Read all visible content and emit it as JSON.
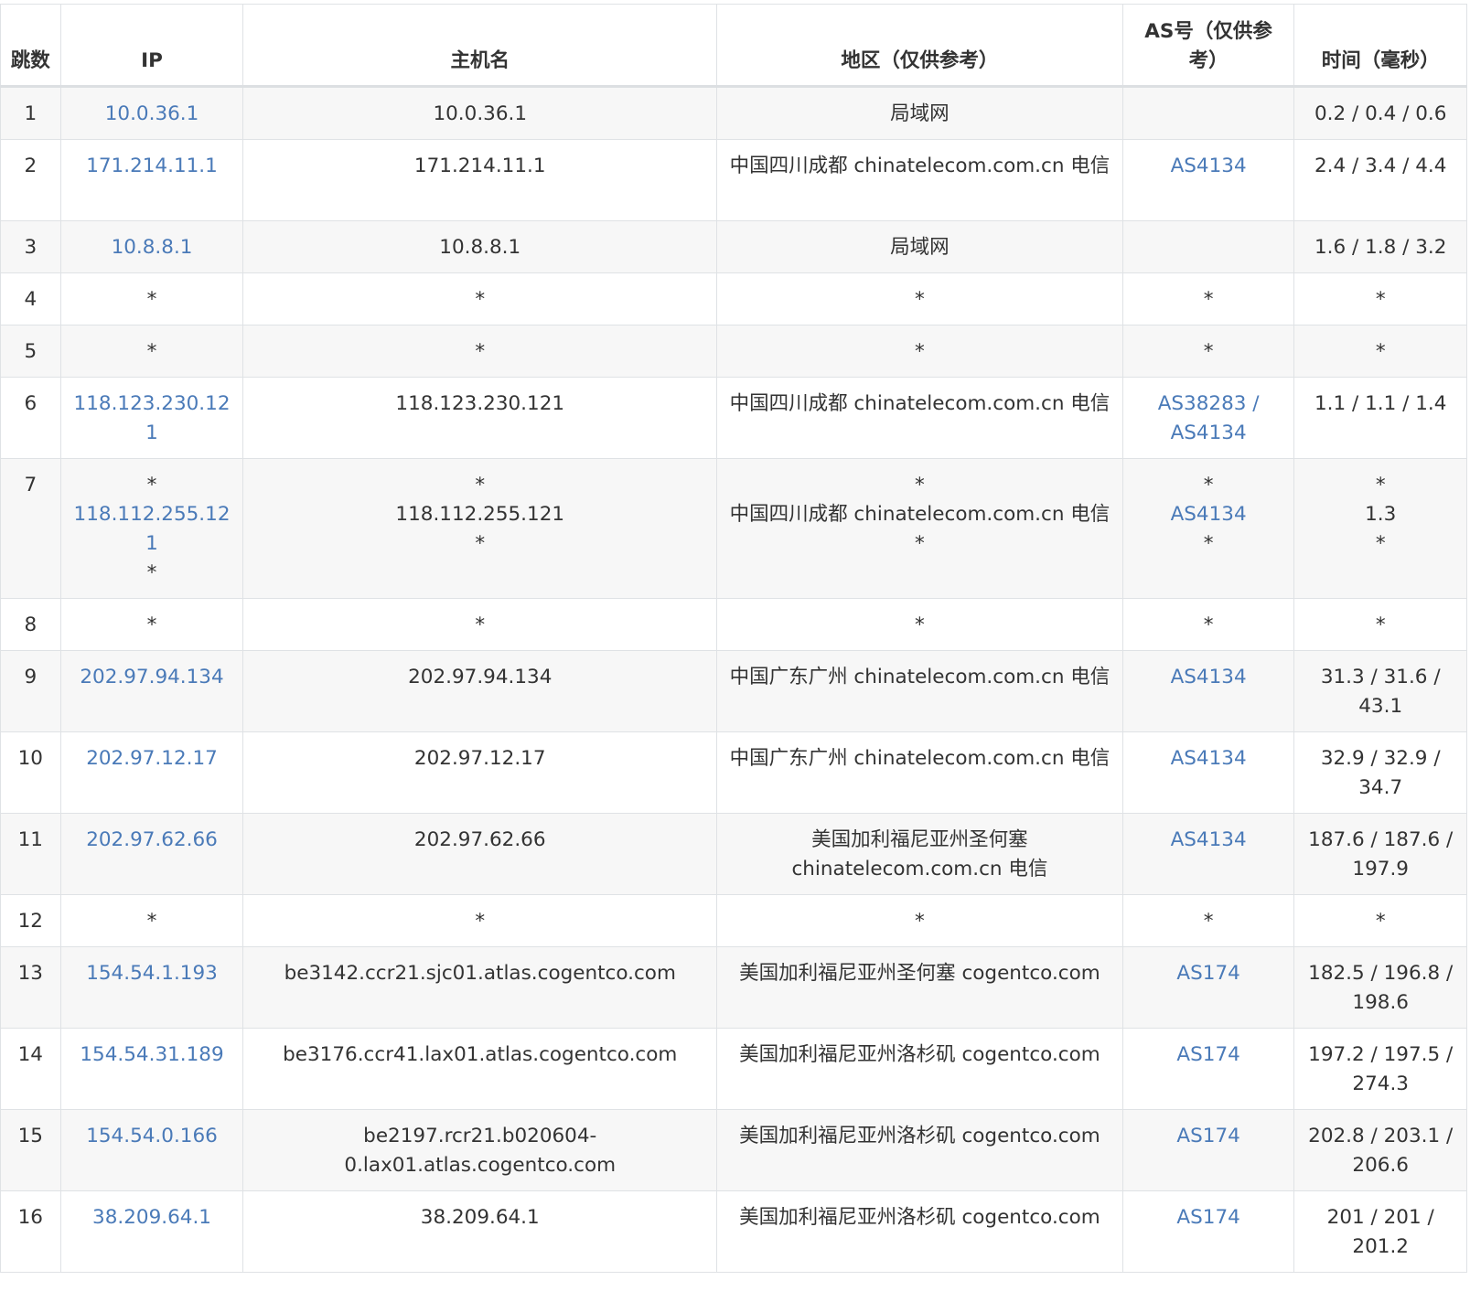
{
  "table": {
    "headers": [
      "跳数",
      "IP",
      "主机名",
      "地区（仅供参考）",
      "AS号（仅供参考）",
      "时间（毫秒）"
    ],
    "rows": [
      {
        "hop": "1",
        "ip": [
          "10.0.36.1"
        ],
        "host": [
          "10.0.36.1"
        ],
        "region": [
          "局域网"
        ],
        "asn": [],
        "time": [
          "0.2 / 0.4 / 0.6"
        ]
      },
      {
        "hop": "2",
        "ip": [
          "171.214.11.1"
        ],
        "host": [
          "171.214.11.1"
        ],
        "region": [
          "中国四川成都 chinatelecom.com.cn 电信"
        ],
        "asn": [
          "AS4134"
        ],
        "time": [
          "2.4 / 3.4 / 4.4"
        ]
      },
      {
        "hop": "3",
        "ip": [
          "10.8.8.1"
        ],
        "host": [
          "10.8.8.1"
        ],
        "region": [
          "局域网"
        ],
        "asn": [],
        "time": [
          "1.6 / 1.8 / 3.2"
        ]
      },
      {
        "hop": "4",
        "ip": [
          "*"
        ],
        "host": [
          "*"
        ],
        "region": [
          "*"
        ],
        "asn": [
          "*"
        ],
        "time": [
          "*"
        ]
      },
      {
        "hop": "5",
        "ip": [
          "*"
        ],
        "host": [
          "*"
        ],
        "region": [
          "*"
        ],
        "asn": [
          "*"
        ],
        "time": [
          "*"
        ]
      },
      {
        "hop": "6",
        "ip": [
          "118.123.230.121"
        ],
        "host": [
          "118.123.230.121"
        ],
        "region": [
          "中国四川成都 chinatelecom.com.cn 电信"
        ],
        "asn": [
          "AS38283 / AS4134"
        ],
        "time": [
          "1.1 / 1.1 / 1.4"
        ]
      },
      {
        "hop": "7",
        "ip": [
          "*",
          "118.112.255.121",
          "*"
        ],
        "host": [
          "*",
          "118.112.255.121",
          "*"
        ],
        "region": [
          "*",
          "中国四川成都 chinatelecom.com.cn 电信",
          "*"
        ],
        "asn": [
          "*",
          "AS4134",
          "*"
        ],
        "time": [
          "*",
          "1.3",
          "*"
        ]
      },
      {
        "hop": "8",
        "ip": [
          "*"
        ],
        "host": [
          "*"
        ],
        "region": [
          "*"
        ],
        "asn": [
          "*"
        ],
        "time": [
          "*"
        ]
      },
      {
        "hop": "9",
        "ip": [
          "202.97.94.134"
        ],
        "host": [
          "202.97.94.134"
        ],
        "region": [
          "中国广东广州 chinatelecom.com.cn 电信"
        ],
        "asn": [
          "AS4134"
        ],
        "time": [
          "31.3 / 31.6 / 43.1"
        ]
      },
      {
        "hop": "10",
        "ip": [
          "202.97.12.17"
        ],
        "host": [
          "202.97.12.17"
        ],
        "region": [
          "中国广东广州 chinatelecom.com.cn 电信"
        ],
        "asn": [
          "AS4134"
        ],
        "time": [
          "32.9 / 32.9 / 34.7"
        ]
      },
      {
        "hop": "11",
        "ip": [
          "202.97.62.66"
        ],
        "host": [
          "202.97.62.66"
        ],
        "region": [
          "美国加利福尼亚州圣何塞 chinatelecom.com.cn 电信"
        ],
        "asn": [
          "AS4134"
        ],
        "time": [
          "187.6 / 187.6 / 197.9"
        ]
      },
      {
        "hop": "12",
        "ip": [
          "*"
        ],
        "host": [
          "*"
        ],
        "region": [
          "*"
        ],
        "asn": [
          "*"
        ],
        "time": [
          "*"
        ]
      },
      {
        "hop": "13",
        "ip": [
          "154.54.1.193"
        ],
        "host": [
          "be3142.ccr21.sjc01.atlas.cogentco.com"
        ],
        "region": [
          "美国加利福尼亚州圣何塞 cogentco.com"
        ],
        "asn": [
          "AS174"
        ],
        "time": [
          "182.5 / 196.8 / 198.6"
        ]
      },
      {
        "hop": "14",
        "ip": [
          "154.54.31.189"
        ],
        "host": [
          "be3176.ccr41.lax01.atlas.cogentco.com"
        ],
        "region": [
          "美国加利福尼亚州洛杉矶 cogentco.com"
        ],
        "asn": [
          "AS174"
        ],
        "time": [
          "197.2 / 197.5 / 274.3"
        ]
      },
      {
        "hop": "15",
        "ip": [
          "154.54.0.166"
        ],
        "host": [
          "be2197.rcr21.b020604-0.lax01.atlas.cogentco.com"
        ],
        "region": [
          "美国加利福尼亚州洛杉矶 cogentco.com"
        ],
        "asn": [
          "AS174"
        ],
        "time": [
          "202.8 / 203.1 / 206.6"
        ]
      },
      {
        "hop": "16",
        "ip": [
          "38.209.64.1"
        ],
        "host": [
          "38.209.64.1"
        ],
        "region": [
          "美国加利福尼亚州洛杉矶 cogentco.com"
        ],
        "asn": [
          "AS174"
        ],
        "time": [
          "201 / 201 / 201.2"
        ]
      }
    ]
  },
  "colors": {
    "link": "#4a7ab8",
    "text": "#333333",
    "border": "#dfe2e5",
    "row_alt": "#f7f7f7"
  }
}
